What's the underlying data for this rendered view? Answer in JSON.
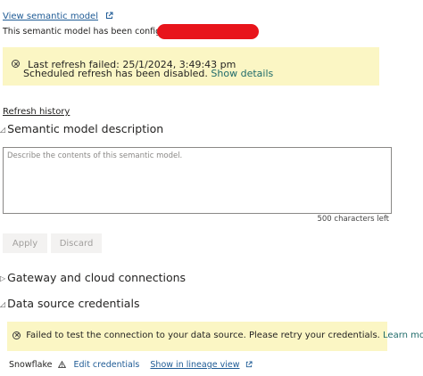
{
  "header": {
    "view_link": "View semantic model",
    "config_text": "This semantic model has been configured b"
  },
  "refresh_banner": {
    "line1": "Last refresh failed: 25/1/2024, 3:49:43 pm",
    "line2": "Scheduled refresh has been disabled.",
    "show_details": "Show details"
  },
  "refresh_history": "Refresh history",
  "description_section": {
    "title": "Semantic model description",
    "placeholder": "Describe the contents of this semantic model.",
    "chars_left": "500 characters left",
    "apply_label": "Apply",
    "discard_label": "Discard"
  },
  "gateway_section": {
    "title": "Gateway and cloud connections"
  },
  "credentials_section": {
    "title": "Data source credentials",
    "banner_text": "Failed to test the connection to your data source. Please retry your credentials.",
    "learn_more": "Learn more",
    "source_name": "Snowflake",
    "edit_credentials": "Edit credentials",
    "lineage_link": "Show in lineage view"
  },
  "colors": {
    "link": "#1f5b95",
    "banner_bg": "#fbf6c4",
    "redaction": "#e8141b",
    "disabled_button_bg": "#f3f2f1"
  }
}
